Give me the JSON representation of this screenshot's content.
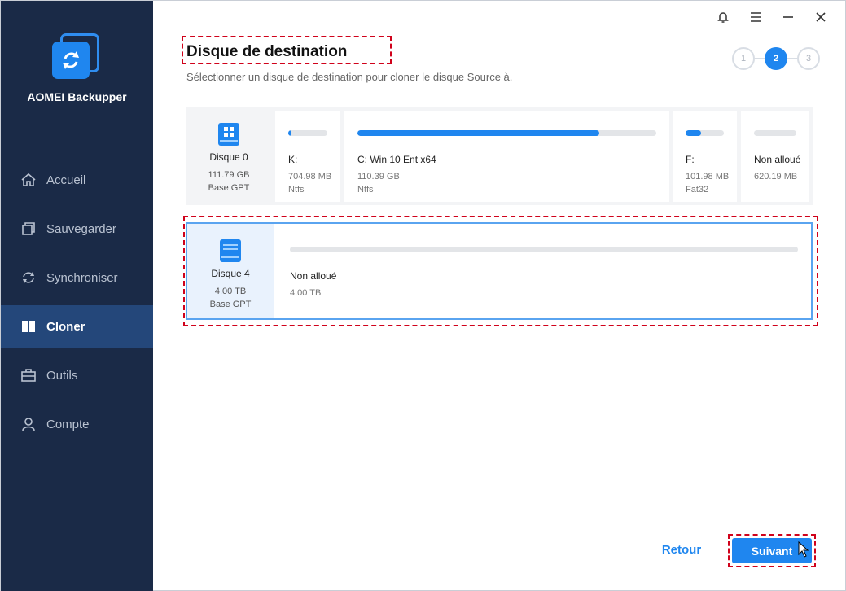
{
  "app": {
    "brand": "AOMEI Backupper"
  },
  "sidebar": {
    "items": [
      {
        "label": "Accueil",
        "icon": "home-icon"
      },
      {
        "label": "Sauvegarder",
        "icon": "backup-icon"
      },
      {
        "label": "Synchroniser",
        "icon": "sync-icon"
      },
      {
        "label": "Cloner",
        "icon": "clone-icon",
        "active": true
      },
      {
        "label": "Outils",
        "icon": "tools-icon"
      },
      {
        "label": "Compte",
        "icon": "account-icon"
      }
    ]
  },
  "header": {
    "title": "Disque de destination",
    "subtitle": "Sélectionner un disque de destination pour cloner le disque Source à."
  },
  "steps": [
    "1",
    "2",
    "3"
  ],
  "active_step": 2,
  "disks": [
    {
      "name": "Disque 0",
      "size": "111.79 GB",
      "type": "Base GPT",
      "partitions": [
        {
          "name": "K:",
          "size": "704.98 MB",
          "fs": "Ntfs",
          "used_fraction": 0.06
        },
        {
          "name": "C: Win 10 Ent x64",
          "size": "110.39 GB",
          "fs": "Ntfs",
          "used_fraction": 0.81
        },
        {
          "name": "F:",
          "size": "101.98 MB",
          "fs": "Fat32",
          "used_fraction": 0.4
        },
        {
          "name": "Non alloué",
          "size": "620.19 MB",
          "fs": "",
          "used_fraction": 0
        }
      ]
    },
    {
      "name": "Disque 4",
      "size": "4.00 TB",
      "type": "Base GPT",
      "partitions": [
        {
          "name": "Non alloué",
          "size": "4.00 TB",
          "fs": "",
          "used_fraction": 0
        }
      ]
    }
  ],
  "footer": {
    "back_label": "Retour",
    "next_label": "Suivant"
  },
  "colors": {
    "accent": "#1f86ef",
    "sidebar": "#1a2a47",
    "highlight": "#d0021b"
  }
}
